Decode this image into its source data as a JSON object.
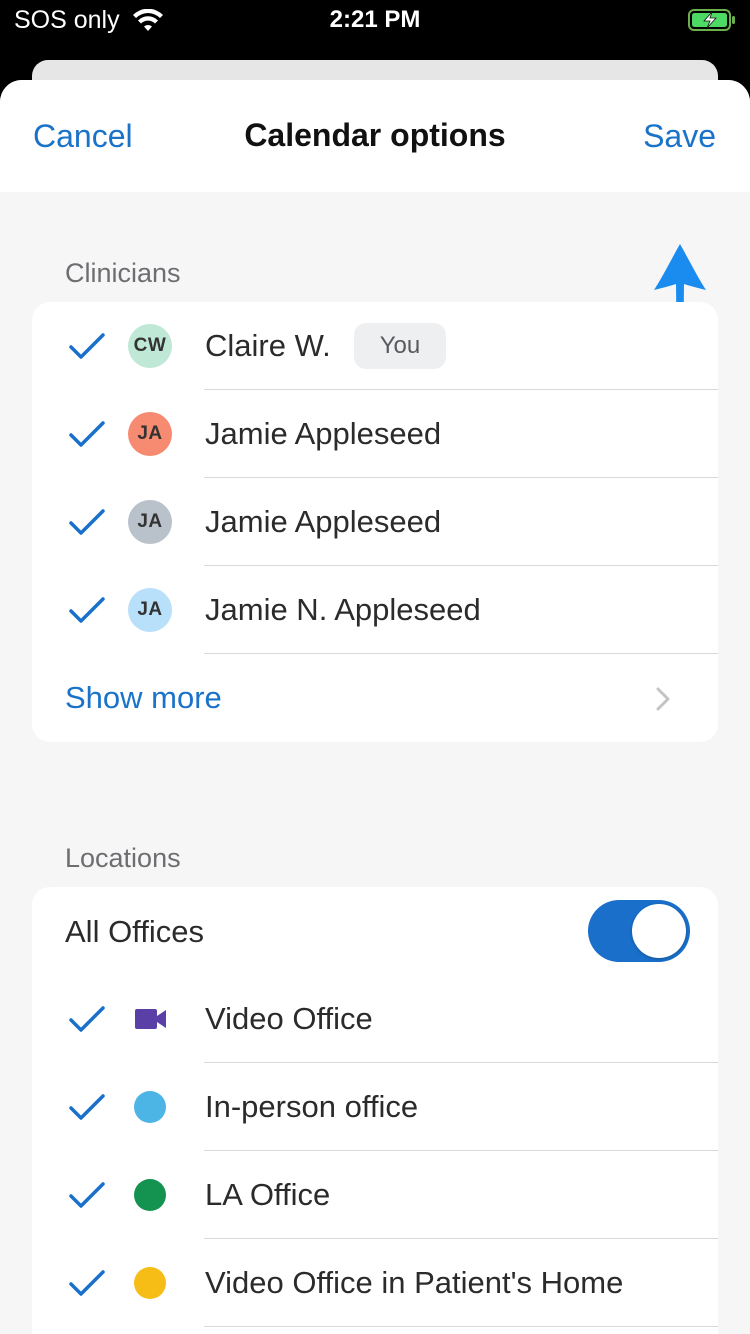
{
  "status_bar": {
    "carrier": "SOS only",
    "time": "2:21 PM"
  },
  "nav": {
    "cancel_label": "Cancel",
    "title": "Calendar options",
    "save_label": "Save"
  },
  "clinicians": {
    "section_label": "Clinicians",
    "items": [
      {
        "initials": "CW",
        "name": "Claire W.",
        "badge": "You",
        "checked": true,
        "avatar_color": "#bfe8d6"
      },
      {
        "initials": "JA",
        "name": "Jamie Appleseed",
        "checked": true,
        "avatar_color": "#f78b71"
      },
      {
        "initials": "JA",
        "name": "Jamie Appleseed",
        "checked": true,
        "avatar_color": "#b9c1cb"
      },
      {
        "initials": "JA",
        "name": "Jamie N. Appleseed",
        "checked": true,
        "avatar_color": "#b8e0fb"
      }
    ],
    "show_more_label": "Show more"
  },
  "locations": {
    "section_label": "Locations",
    "all_offices_label": "All Offices",
    "all_offices_enabled": true,
    "items": [
      {
        "name": "Video Office",
        "icon": "video-camera-icon",
        "color": "#5a3fa7",
        "checked": true
      },
      {
        "name": "In-person office",
        "icon": "circle-dot-icon",
        "color": "#4db4e6",
        "checked": true
      },
      {
        "name": "LA Office",
        "icon": "circle-dot-icon",
        "color": "#14924f",
        "checked": true
      },
      {
        "name": "Video Office in Patient's Home",
        "icon": "circle-dot-icon",
        "color": "#f7bd17",
        "checked": true
      }
    ]
  },
  "colors": {
    "accent": "#1a73c8",
    "toggle_on": "#1a6fcb",
    "annotation_arrow": "#1a8cf0"
  }
}
